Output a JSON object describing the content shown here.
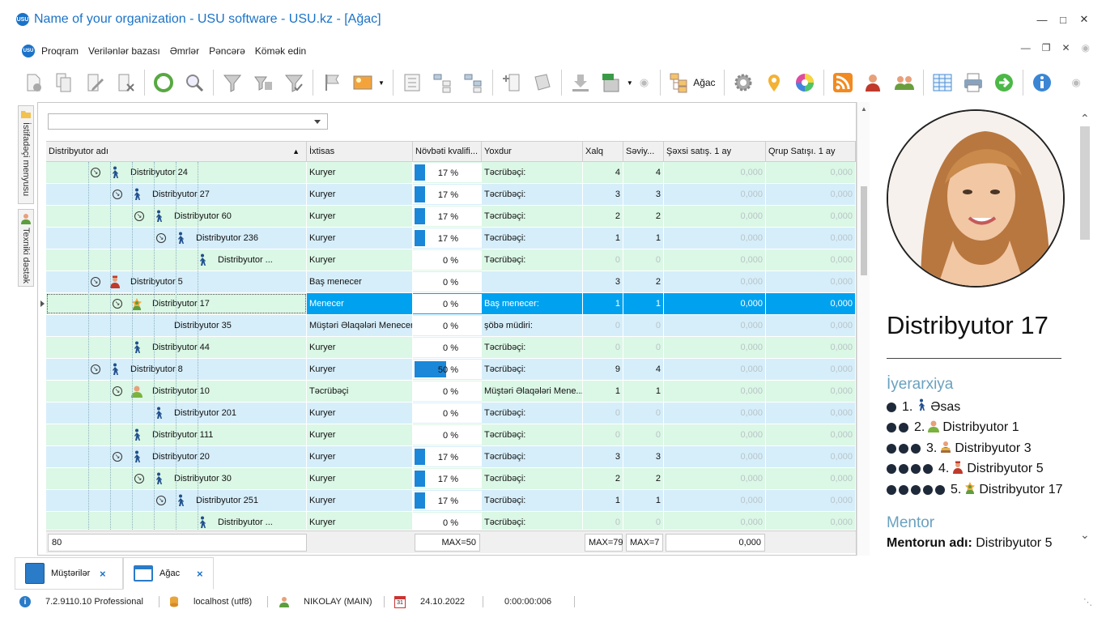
{
  "window": {
    "title": "Name of your organization - USU software - USU.kz - [Ağac]",
    "logo_text": "USU"
  },
  "menu": {
    "items": [
      "Proqram",
      "Verilənlər bazası",
      "Əmrlər",
      "Pəncərə",
      "Kömək edin"
    ]
  },
  "toolbar": {
    "tree_label": "Ağac",
    "icons": [
      "add-icon",
      "copy-icon",
      "edit-icon",
      "delete-icon",
      "refresh-icon",
      "search-icon",
      "filter-icon",
      "filter-settings-icon",
      "filter-apply-icon",
      "flag-icon",
      "image-icon",
      "group-icon",
      "tree-collapse-icon",
      "tree-expand-icon",
      "add-column-icon",
      "notes-icon",
      "import-icon",
      "export-xls-icon",
      "tree-icon",
      "gear-icon",
      "location-icon",
      "color-wheel-icon",
      "rss-icon",
      "user-manager-icon",
      "users-icon",
      "table-icon",
      "print-icon",
      "next-icon",
      "info-icon"
    ]
  },
  "sidebar": {
    "user_menu": "İstifadəçi menyusu",
    "support": "Texniki dəstək"
  },
  "grid": {
    "filter_value": "",
    "columns": [
      "Distribyutor adı",
      "İxtisas",
      "Növbəti kvalifi...",
      "Yoxdur",
      "Xalq",
      "Səviy...",
      "Şəxsi satış. 1 ay",
      "Qrup Satışı. 1 ay"
    ],
    "rows": [
      {
        "name": "Distribyutor 24",
        "spec": "Kuryer",
        "pct": 17,
        "pct_text": "17 %",
        "next": "Təcrübəçi:",
        "xalq": "4",
        "level": "4",
        "personal": "0,000",
        "group": "0,000",
        "depth": 4,
        "icon": "courier-icon",
        "expand": true
      },
      {
        "name": "Distribyutor 27",
        "spec": "Kuryer",
        "pct": 17,
        "pct_text": "17 %",
        "next": "Təcrübəçi:",
        "xalq": "3",
        "level": "3",
        "personal": "0,000",
        "group": "0,000",
        "depth": 5,
        "icon": "courier-icon",
        "expand": true
      },
      {
        "name": "Distribyutor 60",
        "spec": "Kuryer",
        "pct": 17,
        "pct_text": "17 %",
        "next": "Təcrübəçi:",
        "xalq": "2",
        "level": "2",
        "personal": "0,000",
        "group": "0,000",
        "depth": 6,
        "icon": "courier-icon",
        "expand": true
      },
      {
        "name": "Distribyutor 236",
        "spec": "Kuryer",
        "pct": 17,
        "pct_text": "17 %",
        "next": "Təcrübəçi:",
        "xalq": "1",
        "level": "1",
        "personal": "0,000",
        "group": "0,000",
        "depth": 7,
        "icon": "courier-icon",
        "expand": true
      },
      {
        "name": "Distribyutor ...",
        "spec": "Kuryer",
        "pct": 0,
        "pct_text": "0 %",
        "next": "Təcrübəçi:",
        "xalq": "0",
        "level": "0",
        "personal": "0,000",
        "group": "0,000",
        "depth": 8,
        "icon": "courier-icon",
        "expand": false
      },
      {
        "name": "Distribyutor 5",
        "spec": "Baş menecer",
        "pct": 0,
        "pct_text": "0 %",
        "next": "",
        "xalq": "3",
        "level": "2",
        "personal": "0,000",
        "group": "0,000",
        "depth": 4,
        "icon": "head-manager-icon",
        "expand": true
      },
      {
        "name": "Distribyutor 17",
        "spec": "Menecer",
        "pct": 0,
        "pct_text": "0 %",
        "next": "Baş menecer:",
        "xalq": "1",
        "level": "1",
        "personal": "0,000",
        "group": "0,000",
        "depth": 5,
        "icon": "manager-star-icon",
        "expand": true,
        "selected": true
      },
      {
        "name": "Distribyutor 35",
        "spec": "Müştəri Əlaqələri Meneceri",
        "pct": 0,
        "pct_text": "0 %",
        "next": "şöbə müdiri:",
        "xalq": "0",
        "level": "0",
        "personal": "0,000",
        "group": "0,000",
        "depth": 6,
        "icon": "",
        "expand": false
      },
      {
        "name": "Distribyutor 44",
        "spec": "Kuryer",
        "pct": 0,
        "pct_text": "0 %",
        "next": "Təcrübəçi:",
        "xalq": "0",
        "level": "0",
        "personal": "0,000",
        "group": "0,000",
        "depth": 5,
        "icon": "courier-icon",
        "expand": false
      },
      {
        "name": "Distribyutor 8",
        "spec": "Kuryer",
        "pct": 50,
        "pct_text": "50 %",
        "next": "Təcrübəçi:",
        "xalq": "9",
        "level": "4",
        "personal": "0,000",
        "group": "0,000",
        "depth": 4,
        "icon": "courier-icon",
        "expand": true
      },
      {
        "name": "Distribyutor 10",
        "spec": "Təcrübəçi",
        "pct": 0,
        "pct_text": "0 %",
        "next": "Müştəri Əlaqələri Mene...",
        "xalq": "1",
        "level": "1",
        "personal": "0,000",
        "group": "0,000",
        "depth": 5,
        "icon": "trainee-icon",
        "expand": true
      },
      {
        "name": "Distribyutor 201",
        "spec": "Kuryer",
        "pct": 0,
        "pct_text": "0 %",
        "next": "Təcrübəçi:",
        "xalq": "0",
        "level": "0",
        "personal": "0,000",
        "group": "0,000",
        "depth": 6,
        "icon": "courier-icon",
        "expand": false
      },
      {
        "name": "Distribyutor 111",
        "spec": "Kuryer",
        "pct": 0,
        "pct_text": "0 %",
        "next": "Təcrübəçi:",
        "xalq": "0",
        "level": "0",
        "personal": "0,000",
        "group": "0,000",
        "depth": 5,
        "icon": "courier-icon",
        "expand": false
      },
      {
        "name": "Distribyutor 20",
        "spec": "Kuryer",
        "pct": 17,
        "pct_text": "17 %",
        "next": "Təcrübəçi:",
        "xalq": "3",
        "level": "3",
        "personal": "0,000",
        "group": "0,000",
        "depth": 5,
        "icon": "courier-icon",
        "expand": true
      },
      {
        "name": "Distribyutor 30",
        "spec": "Kuryer",
        "pct": 17,
        "pct_text": "17 %",
        "next": "Təcrübəçi:",
        "xalq": "2",
        "level": "2",
        "personal": "0,000",
        "group": "0,000",
        "depth": 6,
        "icon": "courier-icon",
        "expand": true
      },
      {
        "name": "Distribyutor 251",
        "spec": "Kuryer",
        "pct": 17,
        "pct_text": "17 %",
        "next": "Təcrübəçi:",
        "xalq": "1",
        "level": "1",
        "personal": "0,000",
        "group": "0,000",
        "depth": 7,
        "icon": "courier-icon",
        "expand": true
      },
      {
        "name": "Distribyutor ...",
        "spec": "Kuryer",
        "pct": 0,
        "pct_text": "0 %",
        "next": "Təcrübəçi:",
        "xalq": "0",
        "level": "0",
        "personal": "0,000",
        "group": "0,000",
        "depth": 8,
        "icon": "courier-icon",
        "expand": false
      }
    ],
    "footer": {
      "count": "80",
      "max_pct": "MAX=50",
      "max_xalq": "MAX=79",
      "max_level": "MAX=7",
      "sum_personal": "0,000"
    }
  },
  "profile": {
    "name": "Distribyutor 17",
    "hierarchy_title": "İyerarxiya",
    "hierarchy": [
      {
        "num": "1.",
        "label": "Əsas",
        "icon": "courier-icon"
      },
      {
        "num": "2.",
        "label": "Distribyutor 1",
        "icon": "trainee-icon"
      },
      {
        "num": "3.",
        "label": "Distribyutor 3",
        "icon": "manager-icon"
      },
      {
        "num": "4.",
        "label": "Distribyutor 5",
        "icon": "head-manager-icon"
      },
      {
        "num": "5.",
        "label": "Distribyutor 17",
        "icon": "manager-star-icon"
      }
    ],
    "mentor_title": "Mentor",
    "mentor_label": "Mentorun adı:",
    "mentor_value": "Distribyutor 5"
  },
  "tabs": [
    {
      "label": "Müştərilər",
      "close": "×"
    },
    {
      "label": "Ağac",
      "close": "×"
    }
  ],
  "status": {
    "version": "7.2.9110.10 Professional",
    "db": "localhost (utf8)",
    "user": "NIKOLAY (MAIN)",
    "date": "24.10.2022",
    "timer": "0:00:00:006",
    "calendar_day": "31"
  },
  "colors": {
    "accent": "#1a73c8",
    "row_green": "#dbf7e5",
    "row_blue": "#d6eefa",
    "selection": "#00a2f0",
    "progress": "#1a87d8",
    "section": "#6aa1bf"
  }
}
